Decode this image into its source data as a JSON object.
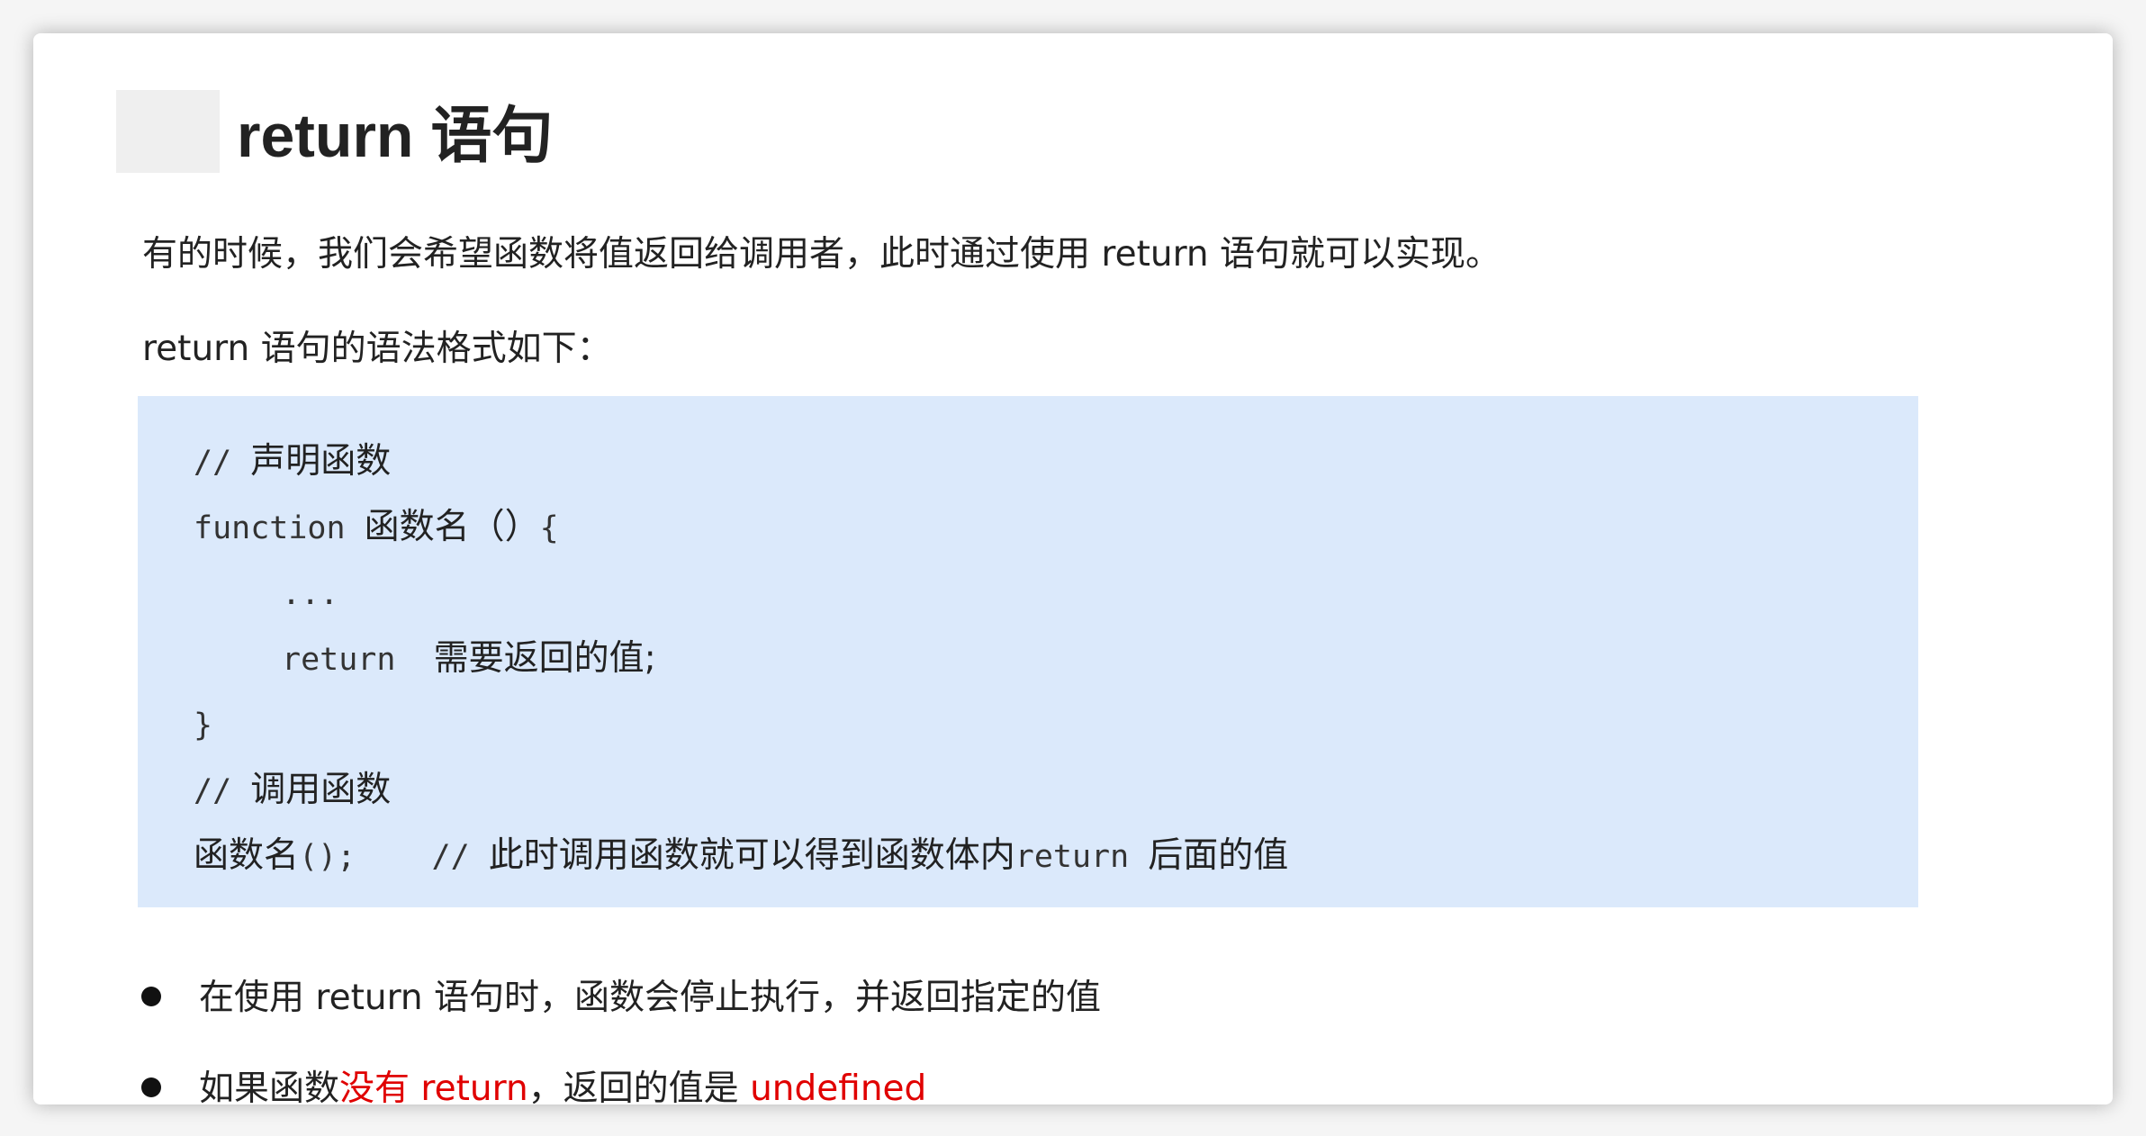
{
  "title": "return 语句",
  "paragraphs": {
    "intro": "有的时候，我们会希望函数将值返回给调用者，此时通过使用 return 语句就可以实现。",
    "syntax": "return 语句的语法格式如下："
  },
  "code": {
    "line1": {
      "comment": "// ",
      "text": "声明函数"
    },
    "line2": {
      "keyword": "function ",
      "name": "函数名（）",
      "brace": "{"
    },
    "line3": {
      "text": "..."
    },
    "line4": {
      "keyword": "return  ",
      "text": "需要返回的值;"
    },
    "line5": {
      "text": "}"
    },
    "line6": {
      "comment": "// ",
      "text": "调用函数"
    },
    "line7": {
      "name": "函数名",
      "call": "();    // ",
      "text": "此时调用函数就可以得到函数体内",
      "keyword": "return ",
      "tail": "后面的值"
    }
  },
  "bullets": {
    "b1": "在使用 return 语句时，函数会停止执行，并返回指定的值",
    "b2": {
      "part1": "如果函数",
      "highlight1": "没有 return",
      "part2": "，返回的值是 ",
      "highlight2": "undefined"
    }
  },
  "colors": {
    "code_background": "#dbe9fb",
    "highlight": "#e00000",
    "text": "#222222"
  }
}
